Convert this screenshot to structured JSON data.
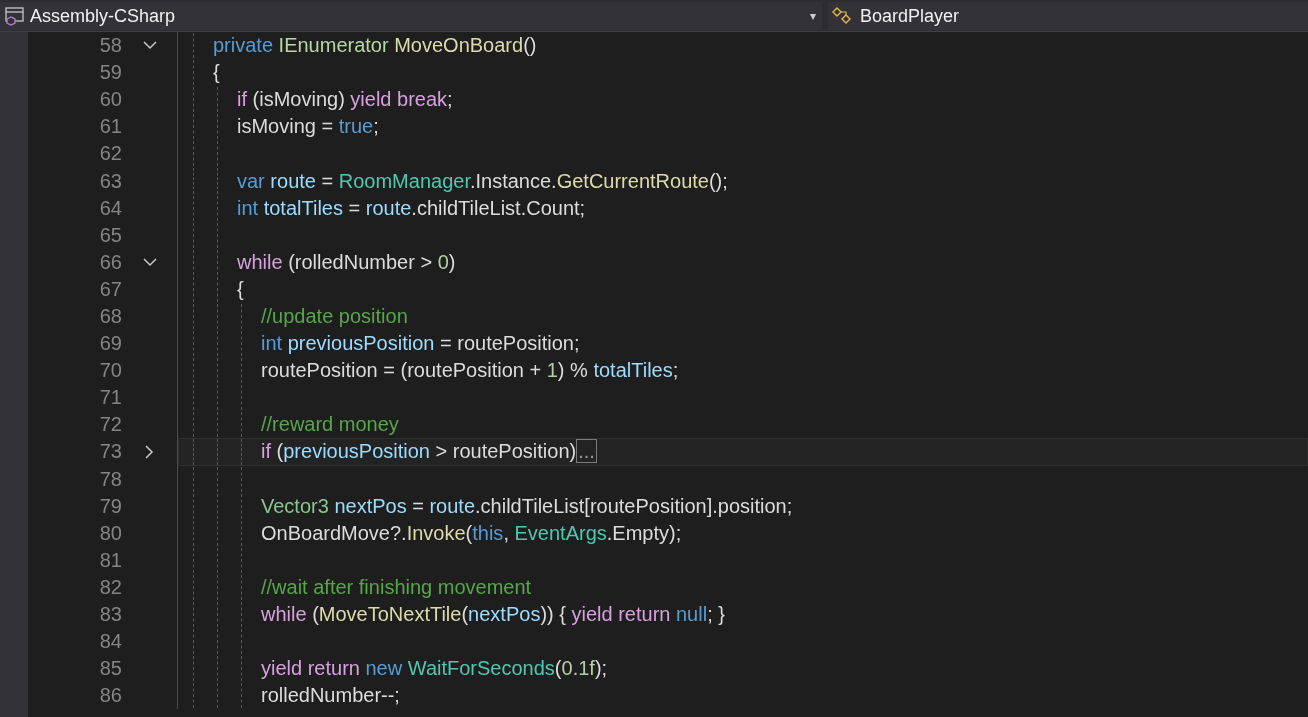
{
  "navigation_bar": {
    "project": "Assembly-CSharp",
    "caret": "▾",
    "member": "BoardPlayer"
  },
  "editor": {
    "lines": [
      {
        "number": "58",
        "expanded": true,
        "current": false,
        "tokens": [
          {
            "kind": "keyword",
            "text": "private"
          },
          {
            "kind": "interface",
            "text": " IEnumerator"
          },
          {
            "kind": "method",
            "text": " MoveOnBoard"
          },
          {
            "kind": "plain",
            "text": "()"
          }
        ]
      },
      {
        "number": "59",
        "current": false,
        "tokens": [
          {
            "kind": "plain",
            "text": "{"
          }
        ],
        "children": [
          {
            "number": "60",
            "current": false,
            "tokens": [
              {
                "kind": "control",
                "text": "if"
              },
              {
                "kind": "plain",
                "text": " (isMoving) "
              },
              {
                "kind": "control",
                "text": "yield break"
              },
              {
                "kind": "plain",
                "text": ";"
              }
            ]
          },
          {
            "number": "61",
            "current": false,
            "tokens": [
              {
                "kind": "plain",
                "text": "isMoving = "
              },
              {
                "kind": "keyword",
                "text": "true"
              },
              {
                "kind": "plain",
                "text": ";"
              }
            ]
          },
          {
            "number": "62",
            "current": false
          },
          {
            "number": "63",
            "current": false,
            "tokens": [
              {
                "kind": "keyword",
                "text": "var"
              },
              {
                "kind": "local",
                "text": " route"
              },
              {
                "kind": "plain",
                "text": " = "
              },
              {
                "kind": "class",
                "text": "RoomManager"
              },
              {
                "kind": "plain",
                "text": ".Instance."
              },
              {
                "kind": "method",
                "text": "GetCurrentRoute"
              },
              {
                "kind": "plain",
                "text": "();"
              }
            ]
          },
          {
            "number": "64",
            "current": false,
            "tokens": [
              {
                "kind": "keyword",
                "text": "int"
              },
              {
                "kind": "local",
                "text": " totalTiles"
              },
              {
                "kind": "plain",
                "text": " = "
              },
              {
                "kind": "local",
                "text": "route"
              },
              {
                "kind": "plain",
                "text": ".childTileList.Count;"
              }
            ]
          },
          {
            "number": "65",
            "current": false
          },
          {
            "number": "66",
            "expanded": true,
            "current": false,
            "tokens": [
              {
                "kind": "control",
                "text": "while"
              },
              {
                "kind": "plain",
                "text": " (rolledNumber > "
              },
              {
                "kind": "number",
                "text": "0"
              },
              {
                "kind": "plain",
                "text": ")"
              }
            ]
          },
          {
            "number": "67",
            "current": false,
            "tokens": [
              {
                "kind": "plain",
                "text": "{"
              }
            ],
            "children": [
              {
                "number": "68",
                "current": false,
                "tokens": [
                  {
                    "kind": "comment",
                    "text": "//update position"
                  }
                ]
              },
              {
                "number": "69",
                "current": false,
                "tokens": [
                  {
                    "kind": "keyword",
                    "text": "int"
                  },
                  {
                    "kind": "local",
                    "text": " previousPosition"
                  },
                  {
                    "kind": "plain",
                    "text": " = routePosition;"
                  }
                ]
              },
              {
                "number": "70",
                "current": false,
                "tokens": [
                  {
                    "kind": "plain",
                    "text": "routePosition = (routePosition + "
                  },
                  {
                    "kind": "number",
                    "text": "1"
                  },
                  {
                    "kind": "plain",
                    "text": ") % "
                  },
                  {
                    "kind": "local",
                    "text": "totalTiles"
                  },
                  {
                    "kind": "plain",
                    "text": ";"
                  }
                ]
              },
              {
                "number": "71",
                "current": false
              },
              {
                "number": "72",
                "current": false,
                "tokens": [
                  {
                    "kind": "comment",
                    "text": "//reward money"
                  }
                ]
              },
              {
                "number": "73",
                "expanded": false,
                "current": true,
                "tokens": [
                  {
                    "kind": "control",
                    "text": "if"
                  },
                  {
                    "kind": "plain",
                    "text": " ("
                  },
                  {
                    "kind": "local",
                    "text": "previousPosition"
                  },
                  {
                    "kind": "plain",
                    "text": " > routePosition)"
                  },
                  {
                    "kind": "collapsed",
                    "text": "..."
                  }
                ]
              },
              {
                "number": "78",
                "current": false
              },
              {
                "number": "79",
                "current": false,
                "tokens": [
                  {
                    "kind": "struct",
                    "text": "Vector3"
                  },
                  {
                    "kind": "local",
                    "text": " nextPos"
                  },
                  {
                    "kind": "plain",
                    "text": " = "
                  },
                  {
                    "kind": "local",
                    "text": "route"
                  },
                  {
                    "kind": "plain",
                    "text": ".childTileList[routePosition].position;"
                  }
                ]
              },
              {
                "number": "80",
                "current": false,
                "tokens": [
                  {
                    "kind": "plain",
                    "text": "OnBoardMove?."
                  },
                  {
                    "kind": "method",
                    "text": "Invoke"
                  },
                  {
                    "kind": "plain",
                    "text": "("
                  },
                  {
                    "kind": "keyword",
                    "text": "this"
                  },
                  {
                    "kind": "plain",
                    "text": ", "
                  },
                  {
                    "kind": "class",
                    "text": "EventArgs"
                  },
                  {
                    "kind": "plain",
                    "text": ".Empty);"
                  }
                ]
              },
              {
                "number": "81",
                "current": false
              },
              {
                "number": "82",
                "current": false,
                "tokens": [
                  {
                    "kind": "comment",
                    "text": "//wait after finishing movement"
                  }
                ]
              },
              {
                "number": "83",
                "current": false,
                "tokens": [
                  {
                    "kind": "control",
                    "text": "while"
                  },
                  {
                    "kind": "plain",
                    "text": " ("
                  },
                  {
                    "kind": "method",
                    "text": "MoveToNextTile"
                  },
                  {
                    "kind": "plain",
                    "text": "("
                  },
                  {
                    "kind": "local",
                    "text": "nextPos"
                  },
                  {
                    "kind": "plain",
                    "text": ")) { "
                  },
                  {
                    "kind": "control",
                    "text": "yield return"
                  },
                  {
                    "kind": "keyword",
                    "text": " null"
                  },
                  {
                    "kind": "plain",
                    "text": "; }"
                  }
                ]
              },
              {
                "number": "84",
                "current": false
              },
              {
                "number": "85",
                "current": false,
                "tokens": [
                  {
                    "kind": "control",
                    "text": "yield return"
                  },
                  {
                    "kind": "keyword",
                    "text": " new"
                  },
                  {
                    "kind": "class",
                    "text": " WaitForSeconds"
                  },
                  {
                    "kind": "plain",
                    "text": "("
                  },
                  {
                    "kind": "number",
                    "text": "0.1f"
                  },
                  {
                    "kind": "plain",
                    "text": ");"
                  }
                ]
              },
              {
                "number": "86",
                "current": false,
                "tokens": [
                  {
                    "kind": "plain",
                    "text": "rolledNumber--;"
                  }
                ]
              }
            ]
          }
        ]
      }
    ]
  }
}
